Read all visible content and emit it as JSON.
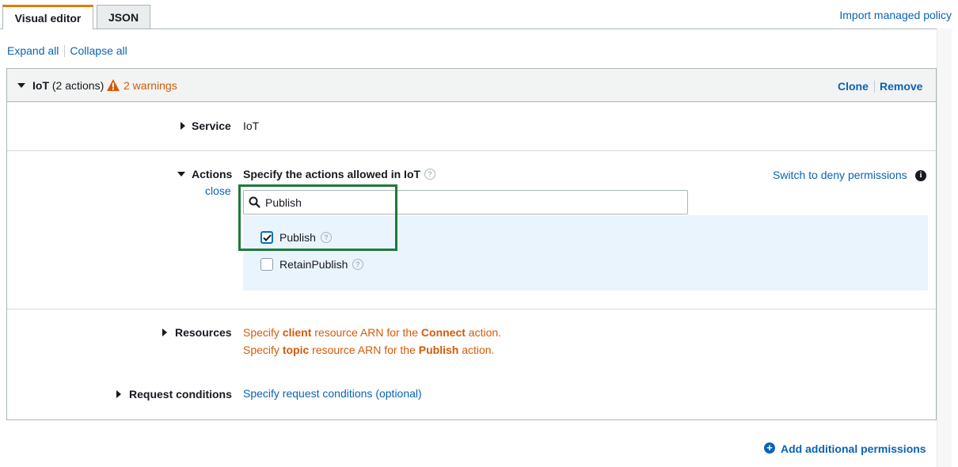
{
  "tabs": [
    {
      "label": "Visual editor",
      "active": true
    },
    {
      "label": "JSON",
      "active": false
    }
  ],
  "import_link": "Import managed policy",
  "expand_all": "Expand all",
  "collapse_all": "Collapse all",
  "panel": {
    "service_name": "IoT",
    "action_count": "(2 actions)",
    "warnings": "2 warnings",
    "clone": "Clone",
    "remove": "Remove"
  },
  "service": {
    "label": "Service",
    "value": "IoT"
  },
  "actions": {
    "label": "Actions",
    "close": "close",
    "heading": "Specify the actions allowed in IoT",
    "switch_link": "Switch to deny permissions",
    "search_value": "Publish",
    "items": [
      {
        "label": "Publish",
        "checked": true
      },
      {
        "label": "RetainPublish",
        "checked": false
      }
    ]
  },
  "resources": {
    "label": "Resources",
    "line1": {
      "pre": "Specify ",
      "b1": "client",
      "mid": " resource ARN for the ",
      "b2": "Connect",
      "post": " action."
    },
    "line2": {
      "pre": "Specify ",
      "b1": "topic",
      "mid": " resource ARN for the ",
      "b2": "Publish",
      "post": " action."
    }
  },
  "request_conditions": {
    "label": "Request conditions",
    "link": "Specify request conditions (optional)"
  },
  "add_permissions": "Add additional permissions",
  "colors": {
    "link": "#0a63b5",
    "warning": "#d45b07",
    "tab_accent": "#e07b00",
    "highlight": "#1d7a3a",
    "list_bg": "#eaf4fd"
  }
}
